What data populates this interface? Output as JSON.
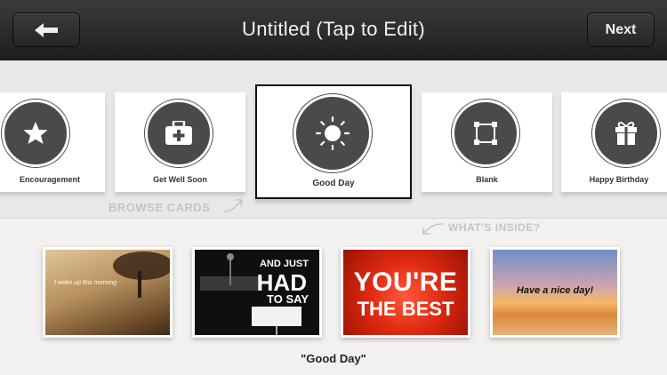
{
  "header": {
    "title": "Untitled (Tap to Edit)",
    "back_icon": "arrow-left-icon",
    "next_label": "Next"
  },
  "cards": [
    {
      "label": "Encouragement",
      "icon": "star-icon"
    },
    {
      "label": "Get Well Soon",
      "icon": "first-aid-kit-icon"
    },
    {
      "label": "Good Day",
      "icon": "sun-icon",
      "selected": true
    },
    {
      "label": "Blank",
      "icon": "blank-frame-icon"
    },
    {
      "label": "Happy Birthday",
      "icon": "gift-icon"
    }
  ],
  "hints": {
    "browse": "BROWSE CARDS",
    "inside": "WHAT'S INSIDE?"
  },
  "previews": [
    {
      "text": "I woke up this morning"
    },
    {
      "line1": "AND JUST",
      "line2": "HAD",
      "line3": "TO SAY"
    },
    {
      "line1": "YOU'RE",
      "line2": "THE BEST"
    },
    {
      "text": "Have a nice day!"
    }
  ],
  "caption": "\"Good Day\"",
  "colors": {
    "header_bg": "#2b2b2b",
    "icon_circle": "#4a4a4a",
    "hint_text": "#c4c4c4"
  }
}
